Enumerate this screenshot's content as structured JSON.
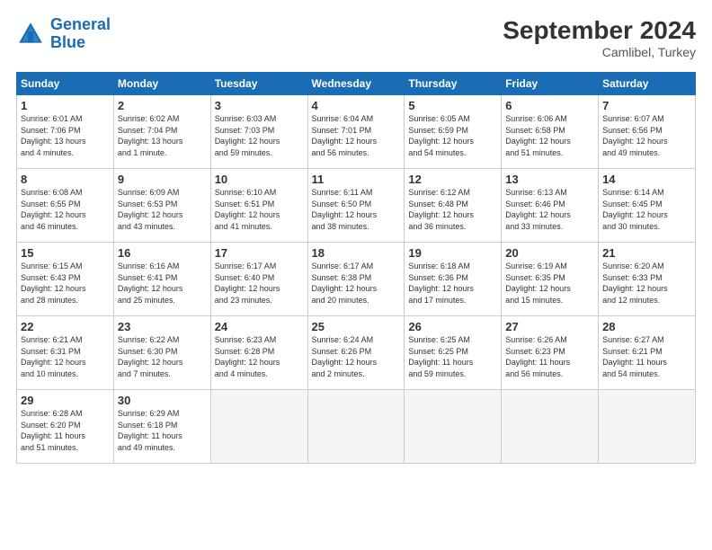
{
  "header": {
    "logo_line1": "General",
    "logo_line2": "Blue",
    "month_title": "September 2024",
    "location": "Camlibel, Turkey"
  },
  "weekdays": [
    "Sunday",
    "Monday",
    "Tuesday",
    "Wednesday",
    "Thursday",
    "Friday",
    "Saturday"
  ],
  "weeks": [
    [
      {
        "day": "1",
        "info": "Sunrise: 6:01 AM\nSunset: 7:06 PM\nDaylight: 13 hours\nand 4 minutes."
      },
      {
        "day": "2",
        "info": "Sunrise: 6:02 AM\nSunset: 7:04 PM\nDaylight: 13 hours\nand 1 minute."
      },
      {
        "day": "3",
        "info": "Sunrise: 6:03 AM\nSunset: 7:03 PM\nDaylight: 12 hours\nand 59 minutes."
      },
      {
        "day": "4",
        "info": "Sunrise: 6:04 AM\nSunset: 7:01 PM\nDaylight: 12 hours\nand 56 minutes."
      },
      {
        "day": "5",
        "info": "Sunrise: 6:05 AM\nSunset: 6:59 PM\nDaylight: 12 hours\nand 54 minutes."
      },
      {
        "day": "6",
        "info": "Sunrise: 6:06 AM\nSunset: 6:58 PM\nDaylight: 12 hours\nand 51 minutes."
      },
      {
        "day": "7",
        "info": "Sunrise: 6:07 AM\nSunset: 6:56 PM\nDaylight: 12 hours\nand 49 minutes."
      }
    ],
    [
      {
        "day": "8",
        "info": "Sunrise: 6:08 AM\nSunset: 6:55 PM\nDaylight: 12 hours\nand 46 minutes."
      },
      {
        "day": "9",
        "info": "Sunrise: 6:09 AM\nSunset: 6:53 PM\nDaylight: 12 hours\nand 43 minutes."
      },
      {
        "day": "10",
        "info": "Sunrise: 6:10 AM\nSunset: 6:51 PM\nDaylight: 12 hours\nand 41 minutes."
      },
      {
        "day": "11",
        "info": "Sunrise: 6:11 AM\nSunset: 6:50 PM\nDaylight: 12 hours\nand 38 minutes."
      },
      {
        "day": "12",
        "info": "Sunrise: 6:12 AM\nSunset: 6:48 PM\nDaylight: 12 hours\nand 36 minutes."
      },
      {
        "day": "13",
        "info": "Sunrise: 6:13 AM\nSunset: 6:46 PM\nDaylight: 12 hours\nand 33 minutes."
      },
      {
        "day": "14",
        "info": "Sunrise: 6:14 AM\nSunset: 6:45 PM\nDaylight: 12 hours\nand 30 minutes."
      }
    ],
    [
      {
        "day": "15",
        "info": "Sunrise: 6:15 AM\nSunset: 6:43 PM\nDaylight: 12 hours\nand 28 minutes."
      },
      {
        "day": "16",
        "info": "Sunrise: 6:16 AM\nSunset: 6:41 PM\nDaylight: 12 hours\nand 25 minutes."
      },
      {
        "day": "17",
        "info": "Sunrise: 6:17 AM\nSunset: 6:40 PM\nDaylight: 12 hours\nand 23 minutes."
      },
      {
        "day": "18",
        "info": "Sunrise: 6:17 AM\nSunset: 6:38 PM\nDaylight: 12 hours\nand 20 minutes."
      },
      {
        "day": "19",
        "info": "Sunrise: 6:18 AM\nSunset: 6:36 PM\nDaylight: 12 hours\nand 17 minutes."
      },
      {
        "day": "20",
        "info": "Sunrise: 6:19 AM\nSunset: 6:35 PM\nDaylight: 12 hours\nand 15 minutes."
      },
      {
        "day": "21",
        "info": "Sunrise: 6:20 AM\nSunset: 6:33 PM\nDaylight: 12 hours\nand 12 minutes."
      }
    ],
    [
      {
        "day": "22",
        "info": "Sunrise: 6:21 AM\nSunset: 6:31 PM\nDaylight: 12 hours\nand 10 minutes."
      },
      {
        "day": "23",
        "info": "Sunrise: 6:22 AM\nSunset: 6:30 PM\nDaylight: 12 hours\nand 7 minutes."
      },
      {
        "day": "24",
        "info": "Sunrise: 6:23 AM\nSunset: 6:28 PM\nDaylight: 12 hours\nand 4 minutes."
      },
      {
        "day": "25",
        "info": "Sunrise: 6:24 AM\nSunset: 6:26 PM\nDaylight: 12 hours\nand 2 minutes."
      },
      {
        "day": "26",
        "info": "Sunrise: 6:25 AM\nSunset: 6:25 PM\nDaylight: 11 hours\nand 59 minutes."
      },
      {
        "day": "27",
        "info": "Sunrise: 6:26 AM\nSunset: 6:23 PM\nDaylight: 11 hours\nand 56 minutes."
      },
      {
        "day": "28",
        "info": "Sunrise: 6:27 AM\nSunset: 6:21 PM\nDaylight: 11 hours\nand 54 minutes."
      }
    ],
    [
      {
        "day": "29",
        "info": "Sunrise: 6:28 AM\nSunset: 6:20 PM\nDaylight: 11 hours\nand 51 minutes."
      },
      {
        "day": "30",
        "info": "Sunrise: 6:29 AM\nSunset: 6:18 PM\nDaylight: 11 hours\nand 49 minutes."
      },
      {
        "day": "",
        "info": ""
      },
      {
        "day": "",
        "info": ""
      },
      {
        "day": "",
        "info": ""
      },
      {
        "day": "",
        "info": ""
      },
      {
        "day": "",
        "info": ""
      }
    ]
  ]
}
